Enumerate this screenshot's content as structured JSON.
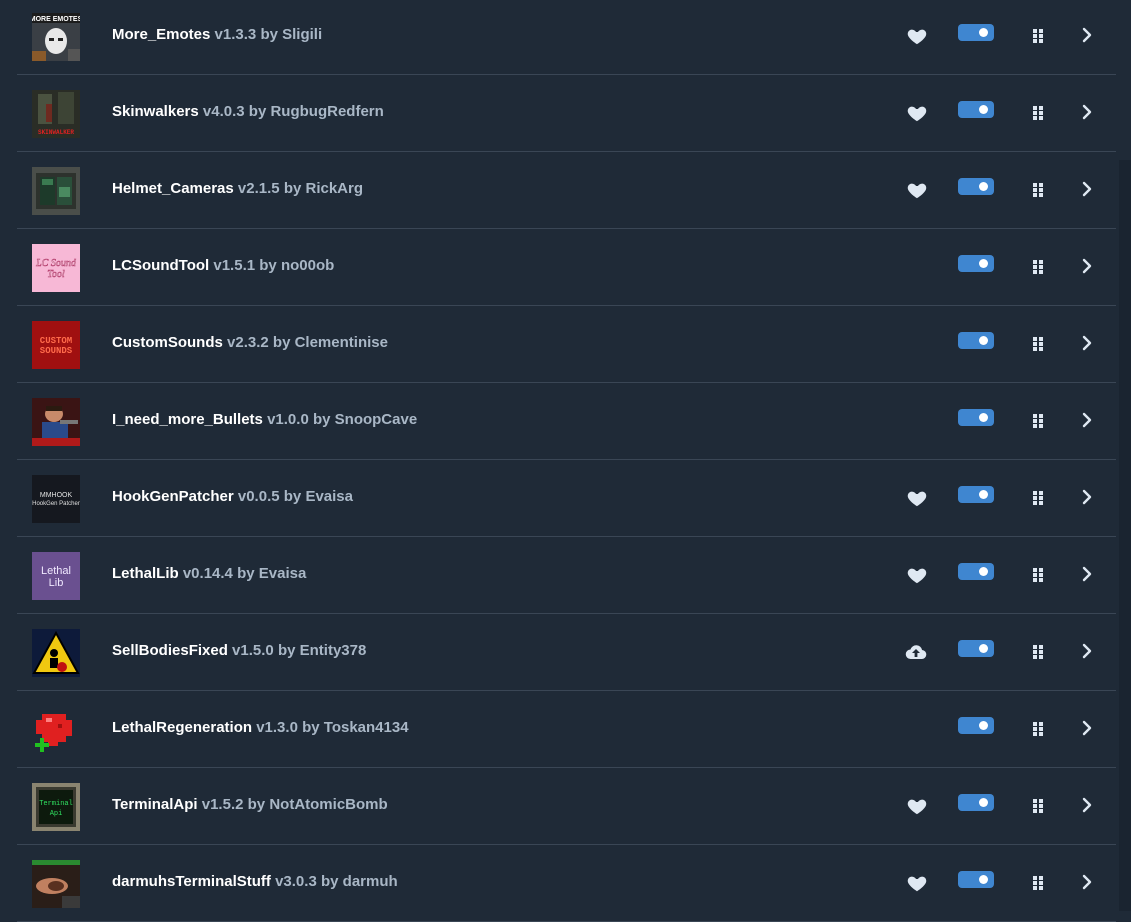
{
  "colors": {
    "background": "#1f2a37",
    "divider": "#3a4655",
    "toggle_on": "#3f86d0",
    "name_text": "#ffffff",
    "meta_text": "#a9b7c6",
    "icon": "#dfe8f2"
  },
  "mods": [
    {
      "name": "More_Emotes",
      "version": "v1.3.3",
      "by": "by",
      "author": "Sligili",
      "action_icon": "heart-icon",
      "enabled": true,
      "thumb_text": "MORE EMOTES"
    },
    {
      "name": "Skinwalkers",
      "version": "v4.0.3",
      "by": "by",
      "author": "RugbugRedfern",
      "action_icon": "heart-icon",
      "enabled": true,
      "thumb_text": "SKINWALKER"
    },
    {
      "name": "Helmet_Cameras",
      "version": "v2.1.5",
      "by": "by",
      "author": "RickArg",
      "action_icon": "heart-icon",
      "enabled": true,
      "thumb_text": ""
    },
    {
      "name": "LCSoundTool",
      "version": "v1.5.1",
      "by": "by",
      "author": "no00ob",
      "action_icon": "",
      "enabled": true,
      "thumb_text": "LC Sound Tool"
    },
    {
      "name": "CustomSounds",
      "version": "v2.3.2",
      "by": "by",
      "author": "Clementinise",
      "action_icon": "",
      "enabled": true,
      "thumb_text": "CUSTOM SOUNDS"
    },
    {
      "name": "I_need_more_Bullets",
      "version": "v1.0.0",
      "by": "by",
      "author": "SnoopCave",
      "action_icon": "",
      "enabled": true,
      "thumb_text": ""
    },
    {
      "name": "HookGenPatcher",
      "version": "v0.0.5",
      "by": "by",
      "author": "Evaisa",
      "action_icon": "heart-icon",
      "enabled": true,
      "thumb_text": "MMHOOK HookGen Patcher"
    },
    {
      "name": "LethalLib",
      "version": "v0.14.4",
      "by": "by",
      "author": "Evaisa",
      "action_icon": "heart-icon",
      "enabled": true,
      "thumb_text": "Lethal Lib"
    },
    {
      "name": "SellBodiesFixed",
      "version": "v1.5.0",
      "by": "by",
      "author": "Entity378",
      "action_icon": "cloud-upload-icon",
      "enabled": true,
      "thumb_text": ""
    },
    {
      "name": "LethalRegeneration",
      "version": "v1.3.0",
      "by": "by",
      "author": "Toskan4134",
      "action_icon": "",
      "enabled": true,
      "thumb_text": ""
    },
    {
      "name": "TerminalApi",
      "version": "v1.5.2",
      "by": "by",
      "author": "NotAtomicBomb",
      "action_icon": "heart-icon",
      "enabled": true,
      "thumb_text": "Terminal Api"
    },
    {
      "name": "darmuhsTerminalStuff",
      "version": "v3.0.3",
      "by": "by",
      "author": "darmuh",
      "action_icon": "heart-icon",
      "enabled": true,
      "thumb_text": ""
    }
  ]
}
